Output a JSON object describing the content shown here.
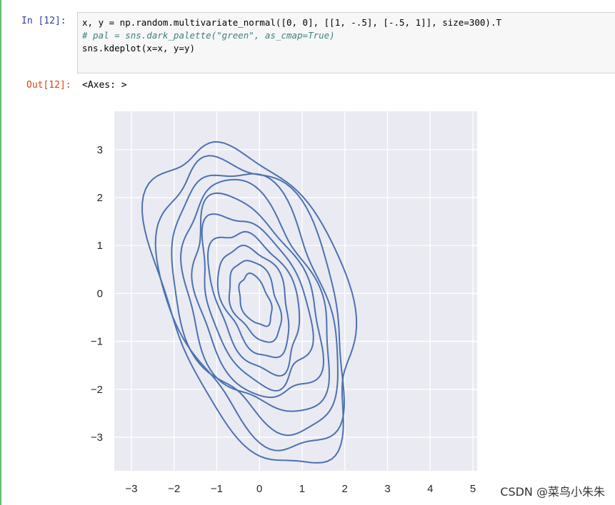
{
  "cell": {
    "in_prompt": "In  [12]:",
    "out_prompt": "Out[12]:",
    "output_text": "<Axes: >",
    "code_lines": [
      "x, y = np.random.multivariate_normal([0, 0], [[1, -.5], [-.5, 1]], size=300).T",
      "# pal = sns.dark_palette(\"green\", as_cmap=True)",
      "sns.kdeplot(x=x, y=y)"
    ]
  },
  "chart_data": {
    "type": "kde-contour",
    "xlim": [
      -3.4,
      5.1
    ],
    "ylim": [
      -3.7,
      3.8
    ],
    "x_ticks": [
      "−3",
      "−2",
      "−1",
      "0",
      "1",
      "2",
      "3",
      "4",
      "5"
    ],
    "y_ticks": [
      "3",
      "2",
      "1",
      "0",
      "−1",
      "−2",
      "−3"
    ],
    "grid": true,
    "background": "#eaeaf2",
    "line_color": "#4c72b0",
    "contour_levels": 10,
    "title": "",
    "xlabel": "",
    "ylabel": ""
  },
  "watermark": "CSDN @菜鸟小朱朱",
  "colors": {
    "cell_bar": "#66bb6a",
    "in_prompt": "#303f9f",
    "out_prompt": "#d84315"
  }
}
